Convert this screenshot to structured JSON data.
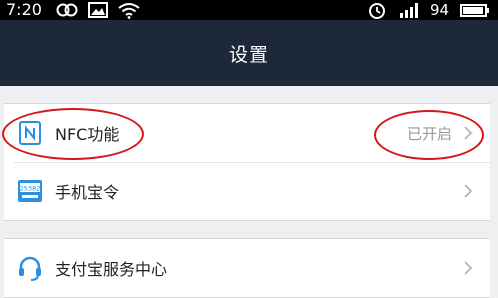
{
  "status_bar": {
    "time": "7:20",
    "battery_level": "94",
    "icons": [
      "link-icon",
      "image-icon",
      "wifi-icon",
      "alarm-icon",
      "signal-icon",
      "battery-icon"
    ]
  },
  "header": {
    "title": "设置"
  },
  "group1": {
    "items": [
      {
        "label": "NFC功能",
        "value": "已开启",
        "icon": "nfc-icon"
      },
      {
        "label": "手机宝令",
        "value": "",
        "icon": "token-icon",
        "icon_text": "25382"
      }
    ]
  },
  "group2": {
    "items": [
      {
        "label": "支付宝服务中心",
        "icon": "headset-icon"
      }
    ]
  },
  "colors": {
    "header_bg": "#1d2838",
    "annotation": "#d3171b",
    "accent_blue": "#2a8fe0"
  }
}
